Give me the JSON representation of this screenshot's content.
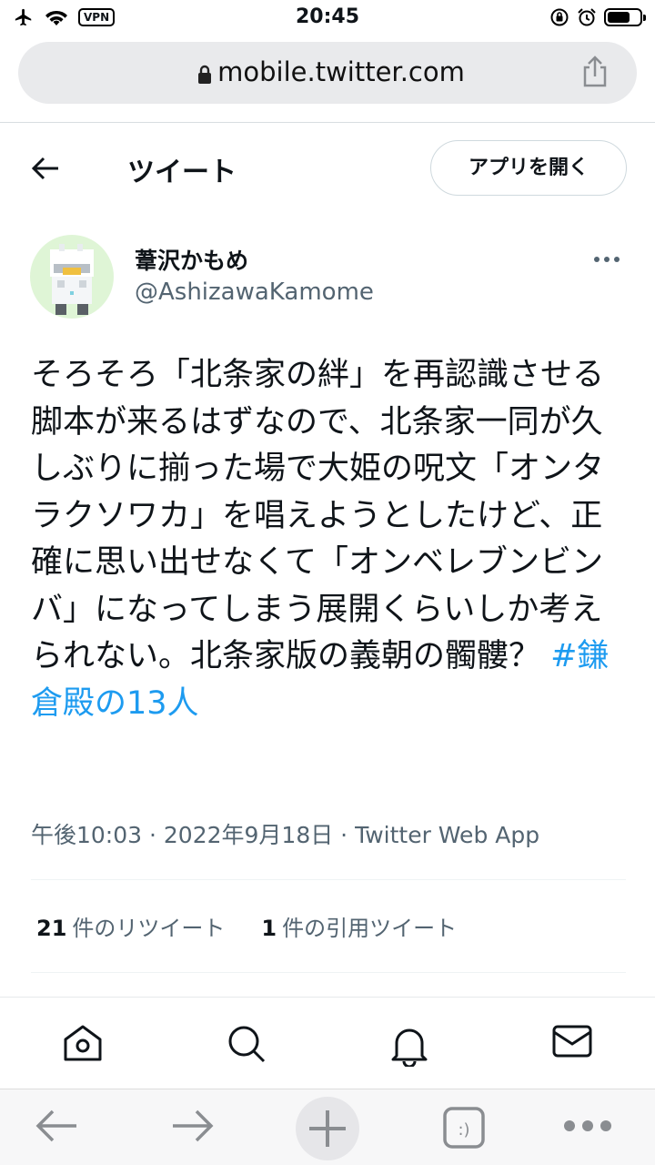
{
  "status_bar": {
    "time": "20:45",
    "vpn": "VPN",
    "battery_level": 0.72
  },
  "browser": {
    "url": "mobile.twitter.com"
  },
  "header": {
    "title": "ツイート",
    "open_app_label": "アプリを開く"
  },
  "tweet": {
    "author": {
      "display_name": "葦沢かもめ",
      "handle": "@AshizawaKamome"
    },
    "text": "そろそろ「北条家の絆」を再認識させる脚本が来るはずなので、北条家一同が久しぶりに揃った場で大姫の呪文「オンタラクソワカ」を唱えようとしたけど、正確に思い出せなくて「オンベレブンビンバ」になってしまう展開くらいしか考えられない。北条家版の義朝の髑髏？ ",
    "hashtag": "#鎌倉殿の13人",
    "meta": "午後10:03 · 2022年9月18日 · Twitter Web App",
    "retweets": {
      "count": "21",
      "label": "件のリツイート"
    },
    "quotes": {
      "count": "1",
      "label": "件の引用ツイート"
    }
  },
  "bottom_nav": [
    "home-icon",
    "search-icon",
    "notifications-icon",
    "messages-icon"
  ],
  "browser_toolbar": [
    "back-icon",
    "forward-icon",
    "new-tab-icon",
    "tabs-icon",
    "menu-icon"
  ],
  "colors": {
    "link": "#1d9bf0",
    "secondary_text": "#536471",
    "primary_text": "#0f1419"
  }
}
